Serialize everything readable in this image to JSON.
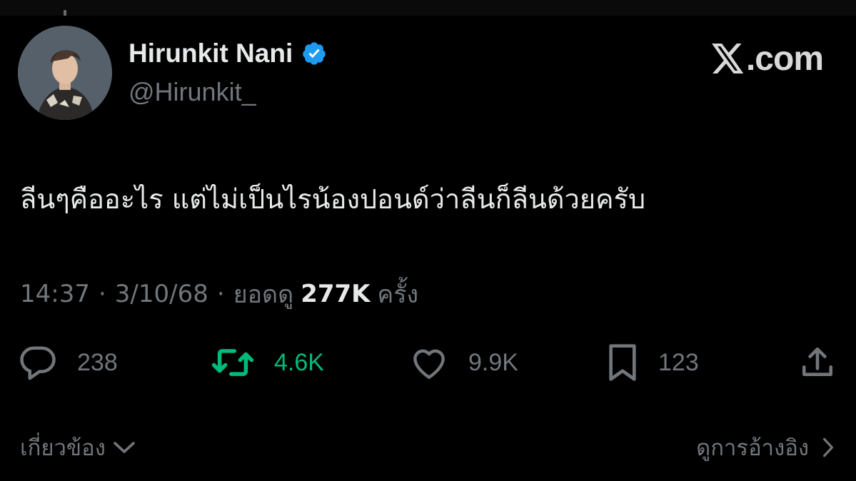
{
  "author": {
    "display_name": "Hirunkit Nani",
    "handle": "@Hirunkit_",
    "verified_icon": "verified-badge-icon",
    "verified_color": "#1d9bf0"
  },
  "brand": {
    "logo_icon": "x-logo-icon",
    "text": ".com"
  },
  "tweet": {
    "text": "ลีนๆคืออะไร แต่ไม่เป็นไรน้องปอนด์ว่าลีนก็ลีนด้วยครับ"
  },
  "meta": {
    "time": "14:37",
    "separator": "·",
    "date": "3/10/68",
    "views_label": "ยอดดู",
    "views_count": "277K",
    "views_unit": "ครั้ง"
  },
  "actions": {
    "reply": {
      "icon": "reply-bubble-icon",
      "count": "238"
    },
    "retweet": {
      "icon": "retweet-icon",
      "count": "4.6K",
      "color": "#00ba7c"
    },
    "like": {
      "icon": "heart-icon",
      "count": "9.9K"
    },
    "bookmark": {
      "icon": "bookmark-icon",
      "count": "123"
    },
    "share": {
      "icon": "share-upload-icon"
    }
  },
  "footer": {
    "related_label": "เกี่ยวข้อง",
    "related_icon": "chevron-down-icon",
    "quotes_label": "ดูการอ้างอิง",
    "quotes_icon": "chevron-right-icon"
  },
  "colors": {
    "background": "#000000",
    "primary_text": "#e7e9ea",
    "secondary_text": "#71767b"
  }
}
